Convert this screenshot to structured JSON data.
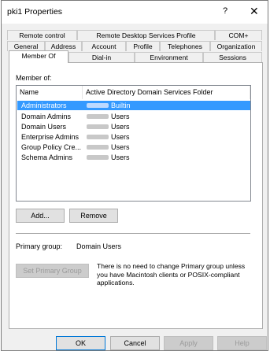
{
  "window": {
    "title": "pki1 Properties",
    "help_glyph": "?",
    "close_glyph": "✕"
  },
  "tabs": {
    "row1": [
      "Remote control",
      "Remote Desktop Services Profile",
      "COM+"
    ],
    "row2": [
      "General",
      "Address",
      "Account",
      "Profile",
      "Telephones",
      "Organization"
    ],
    "row3": [
      "Member Of",
      "Dial-in",
      "Environment",
      "Sessions"
    ],
    "active": "Member Of"
  },
  "member_of": {
    "label": "Member of:",
    "columns": [
      "Name",
      "Active Directory Domain Services Folder"
    ],
    "rows": [
      {
        "name": "Administrators",
        "folder": "Builtin",
        "selected": true
      },
      {
        "name": "Domain Admins",
        "folder": "Users",
        "selected": false
      },
      {
        "name": "Domain Users",
        "folder": "Users",
        "selected": false
      },
      {
        "name": "Enterprise Admins",
        "folder": "Users",
        "selected": false
      },
      {
        "name": "Group Policy Cre...",
        "folder": "Users",
        "selected": false
      },
      {
        "name": "Schema Admins",
        "folder": "Users",
        "selected": false
      }
    ]
  },
  "buttons": {
    "add": "Add...",
    "remove": "Remove",
    "set_primary": "Set Primary Group",
    "ok": "OK",
    "cancel": "Cancel",
    "apply": "Apply",
    "help": "Help"
  },
  "primary_group": {
    "label": "Primary group:",
    "value": "Domain Users",
    "note": "There is no need to change Primary group unless you have Macintosh clients or POSIX-compliant applications."
  },
  "colors": {
    "selection": "#3399ff",
    "dialog_bg": "#f0f0f0",
    "accent_border": "#0078d7"
  }
}
